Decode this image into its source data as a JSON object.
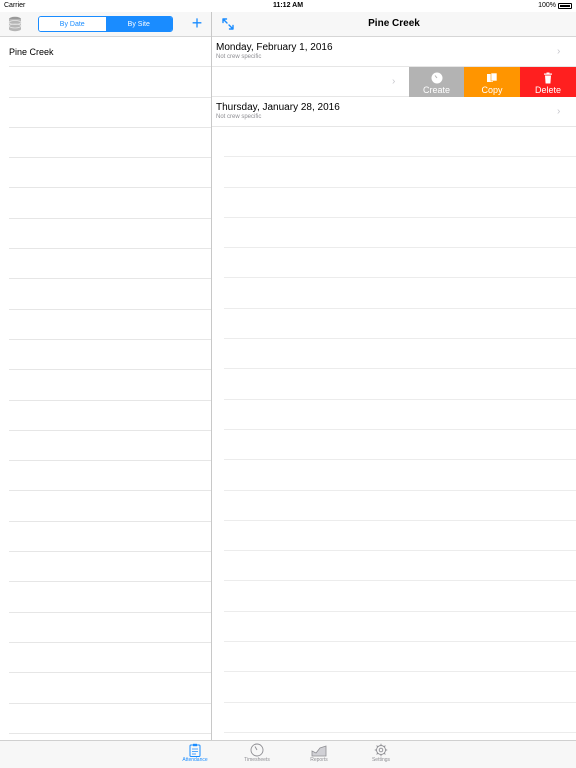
{
  "status": {
    "carrier": "Carrier",
    "time": "11:12 AM",
    "battery": "100%"
  },
  "left": {
    "segments": [
      {
        "label": "By Date",
        "selected": false
      },
      {
        "label": "By Site",
        "selected": true
      }
    ],
    "add_label": "+",
    "sites": [
      "Pine Creek"
    ]
  },
  "right": {
    "title": "Pine Creek",
    "rows": [
      {
        "date": "Monday, February 1, 2016",
        "note": "Not crew specific"
      },
      {
        "date": "Thursday, January 28, 2016",
        "note": "Not crew specific"
      }
    ],
    "actions": {
      "create": "Create",
      "copy": "Copy",
      "delete": "Delete"
    }
  },
  "tabs": [
    {
      "label": "Attendance",
      "active": true
    },
    {
      "label": "Timesheets",
      "active": false
    },
    {
      "label": "Reports",
      "active": false
    },
    {
      "label": "Settings",
      "active": false
    }
  ],
  "colors": {
    "accent": "#1a8cff",
    "create": "#b3b3b3",
    "copy": "#ff9500",
    "delete": "#ff1f1f"
  }
}
